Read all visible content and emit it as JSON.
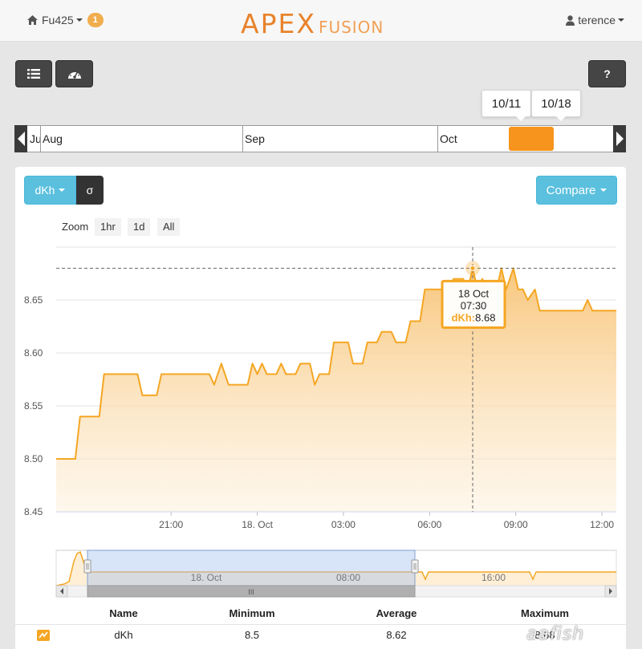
{
  "header": {
    "home_label": "Fu425",
    "notification_count": "1",
    "logo_primary": "APEX",
    "logo_secondary": "FUSION",
    "user_label": "terence"
  },
  "toolbar": {
    "list_icon": "list-icon",
    "dashboard_icon": "dashboard-icon",
    "help_label": "?"
  },
  "date_range": {
    "start": "10/11",
    "end": "10/18"
  },
  "timeline": {
    "months": [
      "Ju",
      "Aug",
      "Sep",
      "Oct"
    ],
    "selection_color": "#f7941d"
  },
  "metric": {
    "selected": "dKh",
    "sigma_label": "σ",
    "compare_label": "Compare"
  },
  "zoom": {
    "label": "Zoom",
    "options": [
      "1hr",
      "1d",
      "All"
    ]
  },
  "tooltip": {
    "date": "18 Oct",
    "time": "07:30",
    "series": "dKh",
    "value": "8.68"
  },
  "navigator": {
    "labels": [
      "18. Oct",
      "08:00",
      "16:00"
    ],
    "handle_label": "III"
  },
  "chart_data": {
    "type": "area",
    "series": [
      {
        "name": "dKh",
        "color": "#f5a623",
        "points": [
          [
            "17 Oct 17:00",
            8.5
          ],
          [
            "17 Oct 17:40",
            8.5
          ],
          [
            "17 Oct 17:50",
            8.54
          ],
          [
            "17 Oct 18:30",
            8.54
          ],
          [
            "17 Oct 18:40",
            8.58
          ],
          [
            "17 Oct 19:50",
            8.58
          ],
          [
            "17 Oct 20:00",
            8.56
          ],
          [
            "17 Oct 20:30",
            8.56
          ],
          [
            "17 Oct 20:40",
            8.58
          ],
          [
            "17 Oct 22:20",
            8.58
          ],
          [
            "17 Oct 22:30",
            8.57
          ],
          [
            "17 Oct 22:45",
            8.59
          ],
          [
            "17 Oct 23:00",
            8.57
          ],
          [
            "17 Oct 23:40",
            8.57
          ],
          [
            "17 Oct 23:50",
            8.59
          ],
          [
            "18 Oct 00:00",
            8.58
          ],
          [
            "18 Oct 00:10",
            8.59
          ],
          [
            "18 Oct 00:20",
            8.58
          ],
          [
            "18 Oct 00:40",
            8.58
          ],
          [
            "18 Oct 00:50",
            8.59
          ],
          [
            "18 Oct 01:00",
            8.58
          ],
          [
            "18 Oct 01:20",
            8.58
          ],
          [
            "18 Oct 01:30",
            8.59
          ],
          [
            "18 Oct 01:50",
            8.59
          ],
          [
            "18 Oct 02:00",
            8.57
          ],
          [
            "18 Oct 02:10",
            8.58
          ],
          [
            "18 Oct 02:30",
            8.58
          ],
          [
            "18 Oct 02:40",
            8.61
          ],
          [
            "18 Oct 03:10",
            8.61
          ],
          [
            "18 Oct 03:20",
            8.59
          ],
          [
            "18 Oct 03:40",
            8.59
          ],
          [
            "18 Oct 03:50",
            8.61
          ],
          [
            "18 Oct 04:10",
            8.61
          ],
          [
            "18 Oct 04:20",
            8.62
          ],
          [
            "18 Oct 04:40",
            8.62
          ],
          [
            "18 Oct 04:50",
            8.61
          ],
          [
            "18 Oct 05:10",
            8.61
          ],
          [
            "18 Oct 05:20",
            8.63
          ],
          [
            "18 Oct 05:40",
            8.63
          ],
          [
            "18 Oct 05:50",
            8.66
          ],
          [
            "18 Oct 06:40",
            8.66
          ],
          [
            "18 Oct 06:50",
            8.67
          ],
          [
            "18 Oct 07:10",
            8.67
          ],
          [
            "18 Oct 07:20",
            8.66
          ],
          [
            "18 Oct 07:30",
            8.68
          ],
          [
            "18 Oct 07:40",
            8.66
          ],
          [
            "18 Oct 07:50",
            8.67
          ],
          [
            "18 Oct 08:00",
            8.66
          ],
          [
            "18 Oct 08:20",
            8.66
          ],
          [
            "18 Oct 08:30",
            8.68
          ],
          [
            "18 Oct 08:40",
            8.66
          ],
          [
            "18 Oct 08:55",
            8.68
          ],
          [
            "18 Oct 09:05",
            8.66
          ],
          [
            "18 Oct 09:15",
            8.66
          ],
          [
            "18 Oct 09:25",
            8.65
          ],
          [
            "18 Oct 09:40",
            8.66
          ],
          [
            "18 Oct 09:50",
            8.64
          ],
          [
            "18 Oct 11:20",
            8.64
          ],
          [
            "18 Oct 11:30",
            8.65
          ],
          [
            "18 Oct 11:40",
            8.64
          ],
          [
            "18 Oct 12:30",
            8.64
          ]
        ]
      }
    ],
    "y_ticks": [
      "8.45",
      "8.50",
      "8.55",
      "8.60",
      "8.65"
    ],
    "x_ticks": [
      "21:00",
      "18. Oct",
      "03:00",
      "06:00",
      "09:00",
      "12:00"
    ],
    "x_range": [
      "17 Oct 17:00",
      "18 Oct 12:30"
    ],
    "ylim": [
      8.45,
      8.7
    ],
    "grid": true,
    "crosshair": {
      "x": "18 Oct 07:30",
      "y": 8.68
    }
  },
  "summary": {
    "headers": [
      "Name",
      "Minimum",
      "Average",
      "Maximum"
    ],
    "rows": [
      {
        "name": "dKh",
        "minimum": "8.5",
        "average": "8.62",
        "maximum": "8.68"
      }
    ]
  },
  "watermark": "aafish"
}
